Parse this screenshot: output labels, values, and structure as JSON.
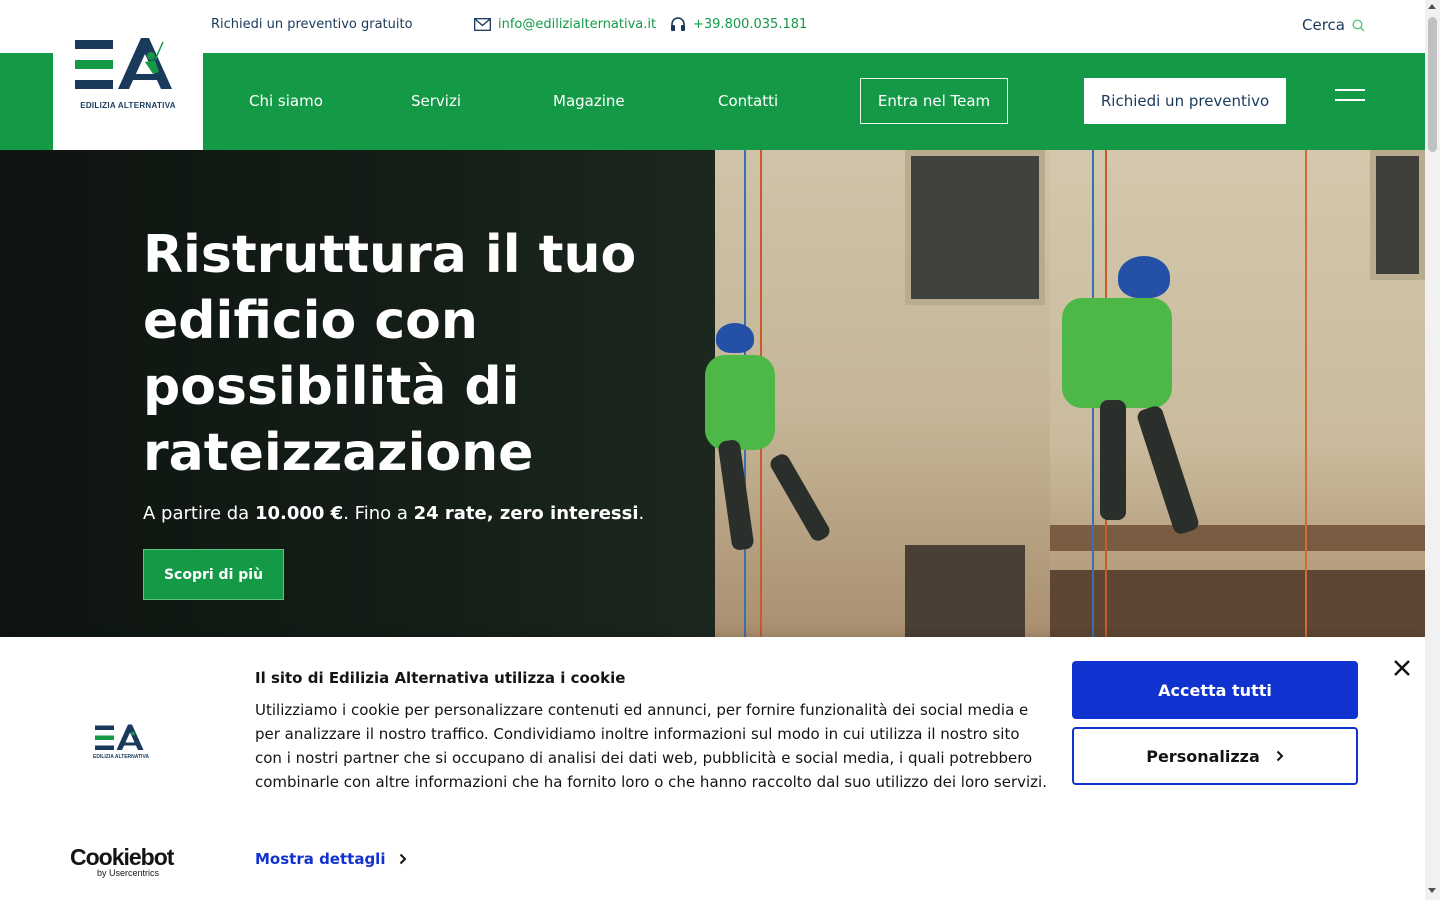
{
  "topbar": {
    "quote_link": "Richiedi un preventivo gratuito",
    "email": "info@edilizialternativa.it",
    "phone": "+39.800.035.181",
    "search_label": "Cerca"
  },
  "logo": {
    "text": "EDILIZIA ALTERNATIVA"
  },
  "nav": {
    "items": [
      {
        "label": "Chi siamo"
      },
      {
        "label": "Servizi"
      },
      {
        "label": "Magazine"
      },
      {
        "label": "Contatti"
      }
    ],
    "team_button": "Entra nel Team",
    "quote_button": "Richiedi un preventivo"
  },
  "hero": {
    "title": "Ristruttura il tuo edificio con possibilità di rateizzazione",
    "subtitle_prefix": "A partire da ",
    "subtitle_amount": "10.000 €",
    "subtitle_mid": ". Fino a ",
    "subtitle_rates": "24 rate, zero interessi",
    "subtitle_end": ".",
    "cta": "Scopri di più"
  },
  "cookie": {
    "title": "Il sito di Edilizia Alternativa utilizza i cookie",
    "body": "Utilizziamo i cookie per personalizzare contenuti ed annunci, per fornire funzionalità dei social media e per analizzare il nostro traffico. Condividiamo inoltre informazioni sul modo in cui utilizza il nostro sito con i nostri partner che si occupano di analisi dei dati web, pubblicità e social media, i quali potrebbero combinarle con altre informazioni che ha fornito loro o che hanno raccolto dal suo utilizzo dei loro servizi.",
    "details_link": "Mostra dettagli",
    "accept_button": "Accetta tutti",
    "customize_button": "Personalizza",
    "brand_name": "Cookiebot",
    "brand_by": "by Usercentrics",
    "logo_text": "EDILIZIA ALTERNATIVA"
  },
  "colors": {
    "brand_green": "#149a47",
    "brand_navy": "#1a3a5c",
    "cookie_blue": "#1032cf"
  }
}
